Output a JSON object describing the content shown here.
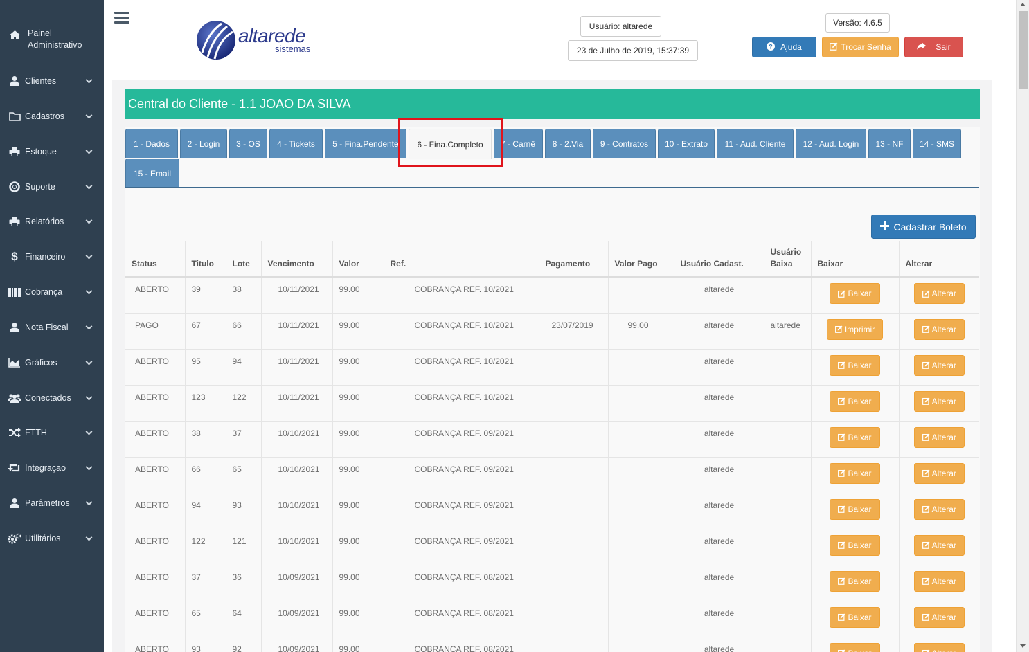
{
  "sidebar": {
    "items": [
      {
        "label": "Painel Administrativo",
        "icon": "home-icon"
      },
      {
        "label": "Clientes",
        "icon": "user-icon"
      },
      {
        "label": "Cadastros",
        "icon": "folder-icon"
      },
      {
        "label": "Estoque",
        "icon": "printer-icon"
      },
      {
        "label": "Suporte",
        "icon": "lifebuoy-icon"
      },
      {
        "label": "Relatórios",
        "icon": "printer-icon"
      },
      {
        "label": "Financeiro",
        "icon": "dollar-icon"
      },
      {
        "label": "Cobrança",
        "icon": "barcode-icon"
      },
      {
        "label": "Nota Fiscal",
        "icon": "user-icon"
      },
      {
        "label": "Gráficos",
        "icon": "area-chart-icon"
      },
      {
        "label": "Conectados",
        "icon": "users-icon"
      },
      {
        "label": "FTTH",
        "icon": "random-icon"
      },
      {
        "label": "Integraçao",
        "icon": "retweet-icon"
      },
      {
        "label": "Parâmetros",
        "icon": "user-icon"
      },
      {
        "label": "Utilitários",
        "icon": "cogs-icon"
      }
    ]
  },
  "header": {
    "logo_word": "altarede",
    "logo_sub": "sistemas",
    "user": "Usuário: altarede",
    "datetime": "23 de Julho de 2019, 15:37:39",
    "version": "Versão: 4.6.5",
    "help_label": "Ajuda",
    "change_password_label": "Trocar Senha",
    "exit_label": "Sair"
  },
  "client_title": "Central do Cliente - 1.1 JOAO DA SILVA",
  "tabs": [
    "1 - Dados",
    "2 - Login",
    "3 - OS",
    "4 - Tickets",
    "5 - Fina.Pendente",
    "6 - Fina.Completo",
    "7 - Carnê",
    "8 - 2.Via",
    "9 - Contratos",
    "10 - Extrato",
    "11 - Aud. Cliente",
    "12 - Aud. Login",
    "13 - NF",
    "14 - SMS",
    "15 - Email"
  ],
  "active_tab": "6 - Fina.Completo",
  "add_boleto_label": "Cadastrar Boleto",
  "table": {
    "headers": {
      "status": "Status",
      "titulo": "Titulo",
      "lote": "Lote",
      "vencimento": "Vencimento",
      "valor": "Valor",
      "ref": "Ref.",
      "pagamento": "Pagamento",
      "valor_pago": "Valor Pago",
      "usuario_cadast": "Usuário Cadast.",
      "usuario_baixa": "Usuário Baixa",
      "baixar": "Baixar",
      "alterar": "Alterar"
    },
    "rows": [
      {
        "status": "ABERTO",
        "titulo": "39",
        "lote": "38",
        "vencimento": "10/11/2021",
        "valor": "99.00",
        "ref": "COBRANÇA REF. 10/2021",
        "pagamento": "",
        "valor_pago": "",
        "usuario_cadast": "altarede",
        "usuario_baixa": "",
        "action": "Baixar",
        "alter": "Alterar"
      },
      {
        "status": "PAGO",
        "titulo": "67",
        "lote": "66",
        "vencimento": "10/11/2021",
        "valor": "99.00",
        "ref": "COBRANÇA REF. 10/2021",
        "pagamento": "23/07/2019",
        "valor_pago": "99.00",
        "usuario_cadast": "altarede",
        "usuario_baixa": "altarede",
        "action": "Imprimir",
        "alter": "Alterar"
      },
      {
        "status": "ABERTO",
        "titulo": "95",
        "lote": "94",
        "vencimento": "10/11/2021",
        "valor": "99.00",
        "ref": "COBRANÇA REF. 10/2021",
        "pagamento": "",
        "valor_pago": "",
        "usuario_cadast": "altarede",
        "usuario_baixa": "",
        "action": "Baixar",
        "alter": "Alterar"
      },
      {
        "status": "ABERTO",
        "titulo": "123",
        "lote": "122",
        "vencimento": "10/11/2021",
        "valor": "99.00",
        "ref": "COBRANÇA REF. 10/2021",
        "pagamento": "",
        "valor_pago": "",
        "usuario_cadast": "altarede",
        "usuario_baixa": "",
        "action": "Baixar",
        "alter": "Alterar"
      },
      {
        "status": "ABERTO",
        "titulo": "38",
        "lote": "37",
        "vencimento": "10/10/2021",
        "valor": "99.00",
        "ref": "COBRANÇA REF. 09/2021",
        "pagamento": "",
        "valor_pago": "",
        "usuario_cadast": "altarede",
        "usuario_baixa": "",
        "action": "Baixar",
        "alter": "Alterar"
      },
      {
        "status": "ABERTO",
        "titulo": "66",
        "lote": "65",
        "vencimento": "10/10/2021",
        "valor": "99.00",
        "ref": "COBRANÇA REF. 09/2021",
        "pagamento": "",
        "valor_pago": "",
        "usuario_cadast": "altarede",
        "usuario_baixa": "",
        "action": "Baixar",
        "alter": "Alterar"
      },
      {
        "status": "ABERTO",
        "titulo": "94",
        "lote": "93",
        "vencimento": "10/10/2021",
        "valor": "99.00",
        "ref": "COBRANÇA REF. 09/2021",
        "pagamento": "",
        "valor_pago": "",
        "usuario_cadast": "altarede",
        "usuario_baixa": "",
        "action": "Baixar",
        "alter": "Alterar"
      },
      {
        "status": "ABERTO",
        "titulo": "122",
        "lote": "121",
        "vencimento": "10/10/2021",
        "valor": "99.00",
        "ref": "COBRANÇA REF. 09/2021",
        "pagamento": "",
        "valor_pago": "",
        "usuario_cadast": "altarede",
        "usuario_baixa": "",
        "action": "Baixar",
        "alter": "Alterar"
      },
      {
        "status": "ABERTO",
        "titulo": "37",
        "lote": "36",
        "vencimento": "10/09/2021",
        "valor": "99.00",
        "ref": "COBRANÇA REF. 08/2021",
        "pagamento": "",
        "valor_pago": "",
        "usuario_cadast": "altarede",
        "usuario_baixa": "",
        "action": "Baixar",
        "alter": "Alterar"
      },
      {
        "status": "ABERTO",
        "titulo": "65",
        "lote": "64",
        "vencimento": "10/09/2021",
        "valor": "99.00",
        "ref": "COBRANÇA REF. 08/2021",
        "pagamento": "",
        "valor_pago": "",
        "usuario_cadast": "altarede",
        "usuario_baixa": "",
        "action": "Baixar",
        "alter": "Alterar"
      },
      {
        "status": "ABERTO",
        "titulo": "93",
        "lote": "92",
        "vencimento": "10/09/2021",
        "valor": "99.00",
        "ref": "COBRANÇA REF. 08/2021",
        "pagamento": "",
        "valor_pago": "",
        "usuario_cadast": "altarede",
        "usuario_baixa": "",
        "action": "Baixar",
        "alter": "Alterar"
      }
    ]
  },
  "colors": {
    "sidebar": "#2f4050",
    "accent_green": "#26b99a",
    "tab_blue": "#5b8fbc",
    "primary": "#337ab7",
    "warning": "#f0ad4e",
    "danger": "#d9534f",
    "highlight_red": "#e0141c"
  }
}
